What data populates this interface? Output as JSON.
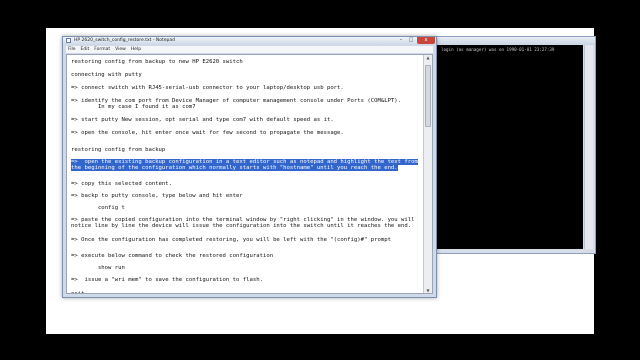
{
  "terminal": {
    "log_line": "login (as manager) was on 1990-01-01 23:27:39"
  },
  "notepad": {
    "title": "HP 2620_switch_config_restore.txt - Notepad",
    "controls": {
      "minimize": "–",
      "maximize": "□",
      "close": "x"
    },
    "menu": [
      "File",
      "Edit",
      "Format",
      "View",
      "Help"
    ],
    "lines": [
      "restoring config from backup to new HP E2620 switch",
      "connecting with putty",
      "=> connect switch with RJ45-serial-usb connector to your laptop/desktop usb port.",
      "=> identify the com port from Device Manager of computer management console under Ports (COM&LPT).",
      "        In my case I found it as com7",
      "=> start putty New session, opt serial and type com7 with default speed as it.",
      "=> open the console, hit enter once wait for few second to propagate the message.",
      "restoring config from backup",
      "=>  open the existing backup configuration in a text editor such as notepad and highlight the text from",
      "the beginning of the configuration which normally starts with \"hostname\" until you reach the end.",
      "=> copy this selected content.",
      "=> backp to putty console, type below and hit enter",
      "        config t",
      "=> paste the copied configuration into the terminal window by \"right clicking\" in the window. you will",
      "notice line by line the device will issue the configuration into the switch until it reaches the end.",
      "=> Once the configuration has completed restoring, you will be left with the \"(config)#\" prompt",
      "=> execute below command to check the restored configuration",
      "        show run",
      "=>  issue a \"wri mem\" to save the configuration to flash.",
      "exit",
      "--------------------------------------------------------------------------------------------------------"
    ]
  }
}
